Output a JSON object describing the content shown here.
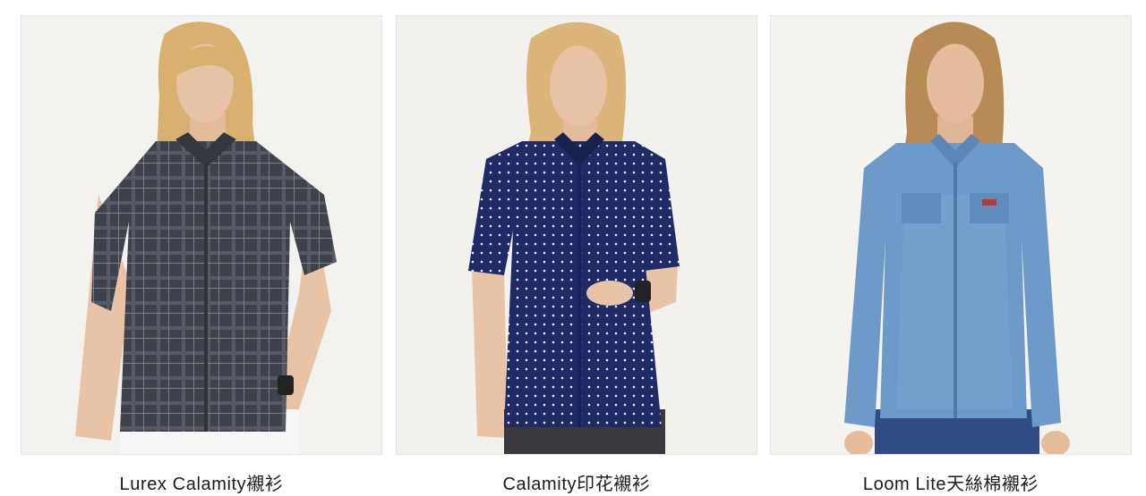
{
  "products": [
    {
      "name": "Lurex Calamity襯衫",
      "image_icon": "model-in-grey-plaid-shirt-photo"
    },
    {
      "name": "Calamity印花襯衫",
      "image_icon": "model-in-navy-polka-dot-shirt-photo"
    },
    {
      "name": "Loom Lite天絲棉襯衫",
      "image_icon": "model-in-light-denim-shirt-photo"
    }
  ],
  "colors": {
    "background": "#ffffff",
    "photo_bg": "#f3f2ef",
    "text": "#1a1a1a",
    "hair": "#d9b070",
    "skin": "#e8c3a6",
    "shirt_plaid": "#44464f",
    "shirt_navy": "#1f2a66",
    "shirt_denim": "#6d9ac8"
  }
}
